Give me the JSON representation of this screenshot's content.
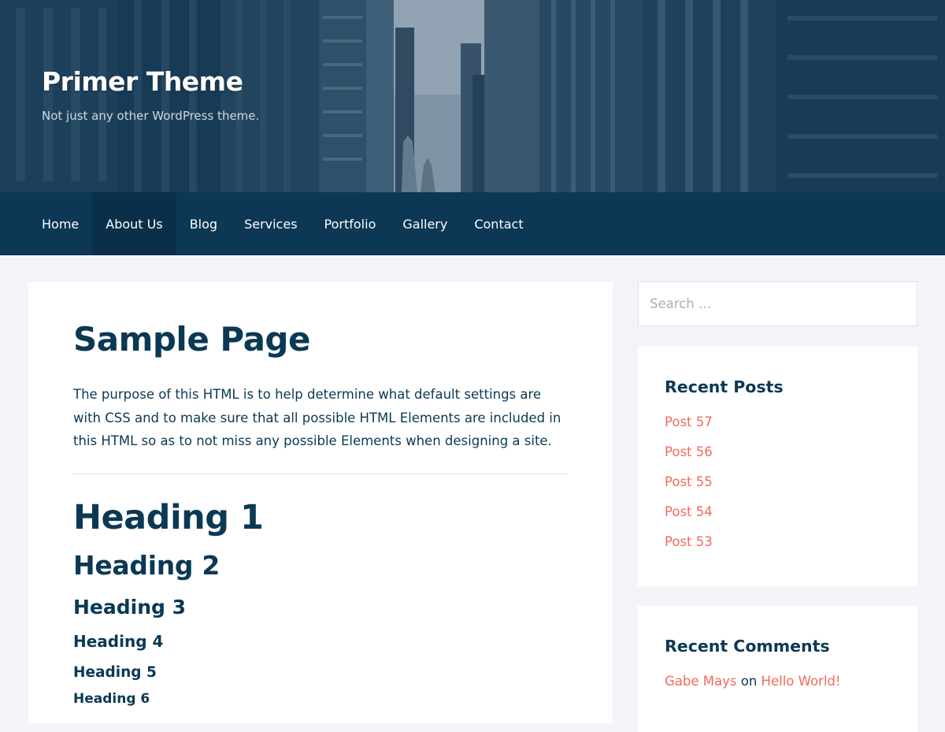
{
  "header": {
    "site_title": "Primer Theme",
    "tagline": "Not just any other WordPress theme."
  },
  "nav": {
    "items": [
      {
        "label": "Home"
      },
      {
        "label": "About Us"
      },
      {
        "label": "Blog"
      },
      {
        "label": "Services"
      },
      {
        "label": "Portfolio"
      },
      {
        "label": "Gallery"
      },
      {
        "label": "Contact"
      }
    ],
    "active_index": 1
  },
  "main": {
    "title": "Sample Page",
    "intro": "The purpose of this HTML is to help determine what default settings are with CSS and to make sure that all possible HTML Elements are included in this HTML so as to not miss any possible Elements when designing a site.",
    "headings": {
      "h1": "Heading 1",
      "h2": "Heading 2",
      "h3": "Heading 3",
      "h4": "Heading 4",
      "h5": "Heading 5",
      "h6": "Heading 6"
    }
  },
  "sidebar": {
    "search": {
      "placeholder": "Search …",
      "value": ""
    },
    "recent_posts": {
      "title": "Recent Posts",
      "items": [
        {
          "label": "Post 57"
        },
        {
          "label": "Post 56"
        },
        {
          "label": "Post 55"
        },
        {
          "label": "Post 54"
        },
        {
          "label": "Post 53"
        }
      ]
    },
    "recent_comments": {
      "title": "Recent Comments",
      "items": [
        {
          "author": "Gabe Mays",
          "connector": "on",
          "post": "Hello World!"
        }
      ]
    }
  },
  "colors": {
    "primary_text": "#0b3954",
    "nav_background": "#0c3755",
    "link": "#f06a5d",
    "page_background": "#f3f4f8"
  }
}
